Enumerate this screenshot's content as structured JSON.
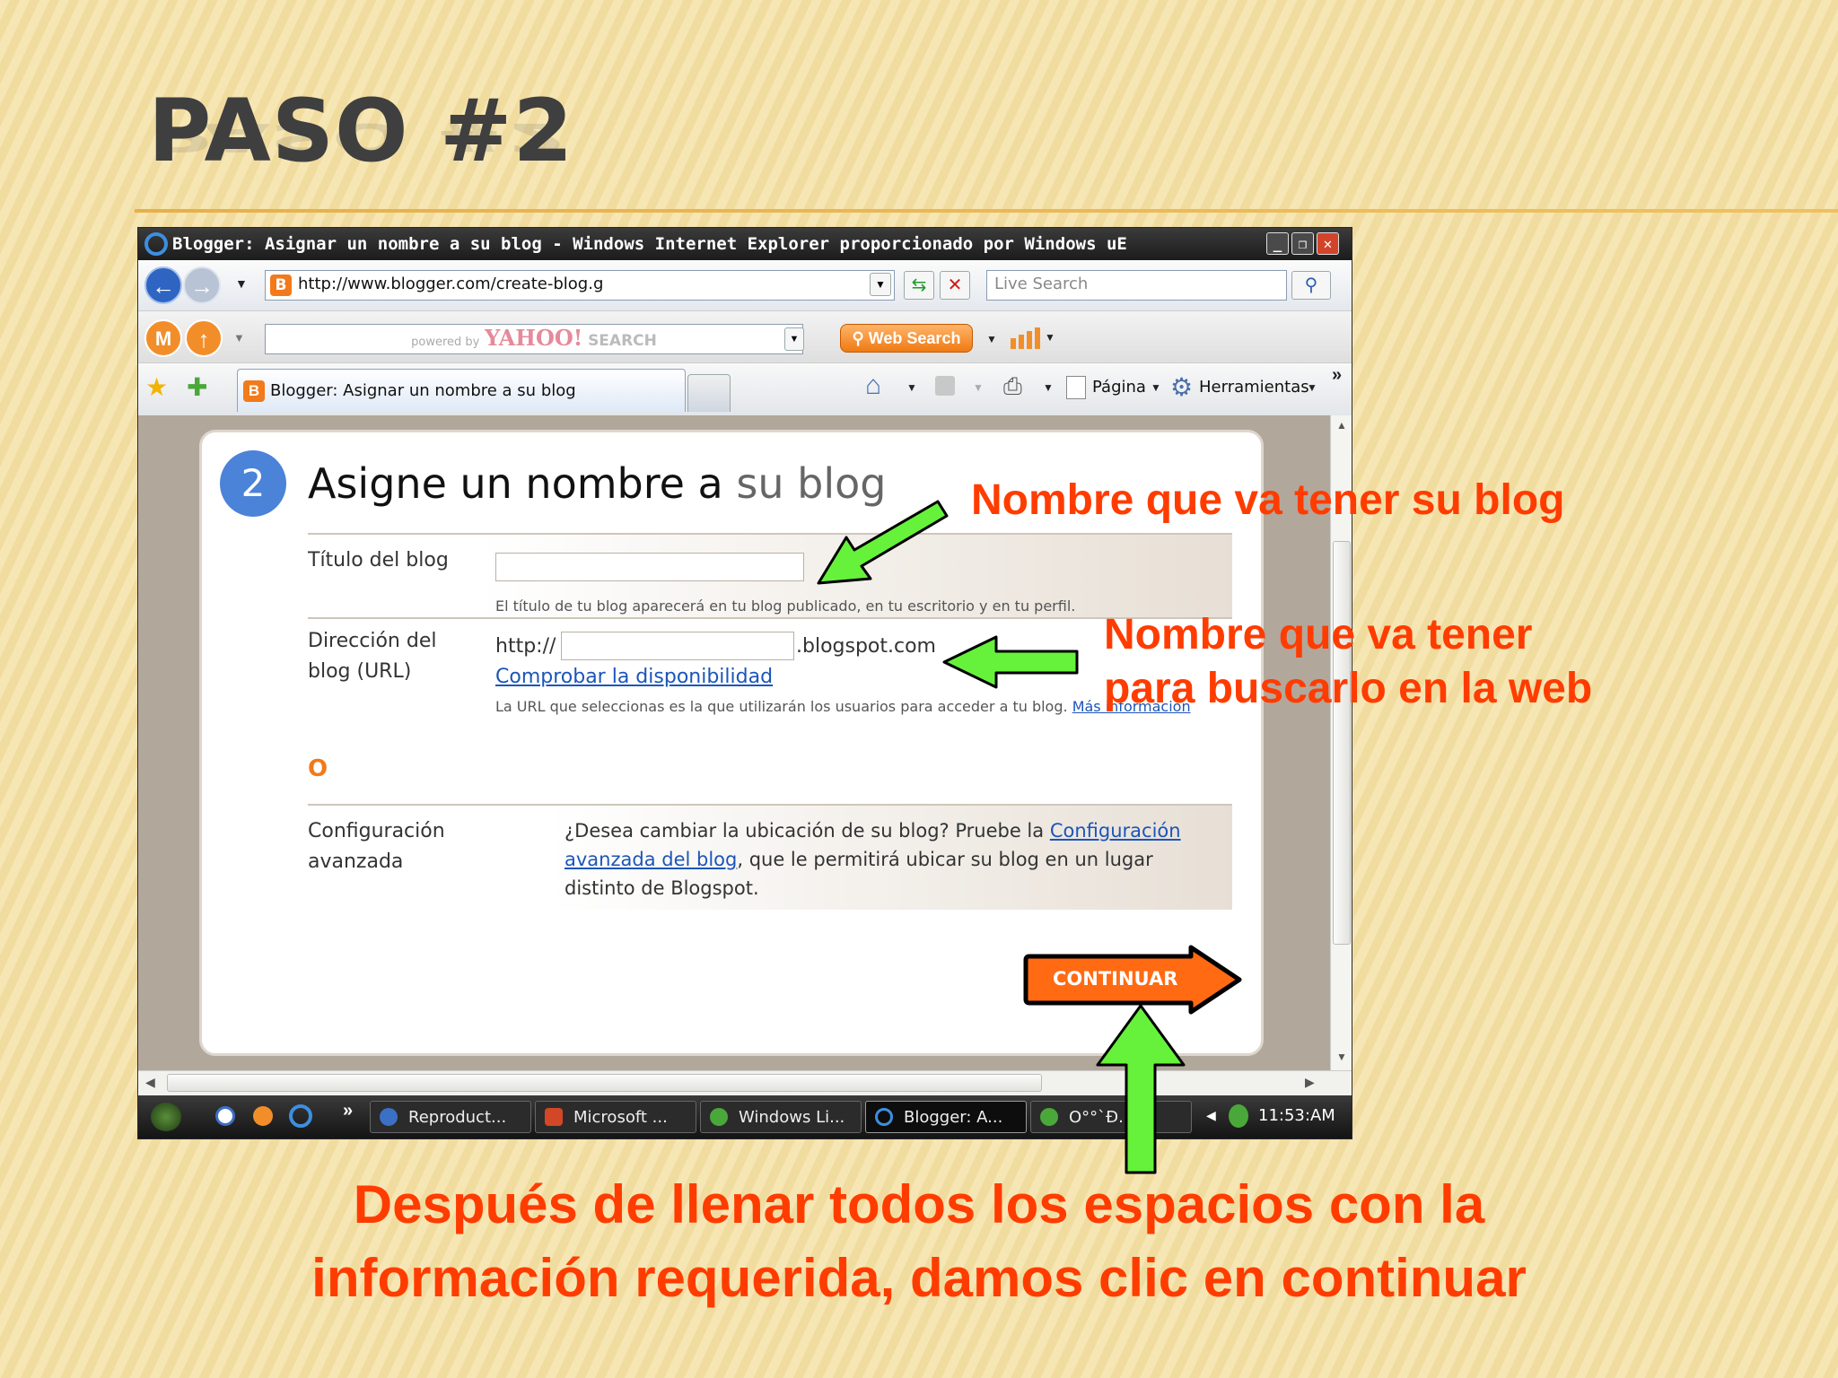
{
  "slide": {
    "title": "PASO #2"
  },
  "browser": {
    "window_title": "Blogger: Asignar un nombre a su blog - Windows Internet Explorer proporcionado por Windows uE",
    "address_url": "http://www.blogger.com/create-blog.g",
    "search_placeholder": "Live Search",
    "yahoo_powered": "powered by",
    "yahoo_brand": "YAHOO!",
    "yahoo_search": "SEARCH",
    "web_search_button": "Web Search",
    "tab_title": "Blogger: Asignar un nombre a su blog",
    "menu_pagina": "Página",
    "menu_herramientas": "Herramientas",
    "more_chevron": "»"
  },
  "form": {
    "step_number": "2",
    "heading_main": "Asigne un nombre a",
    "heading_sub": "su blog",
    "title_label": "Título del blog",
    "title_hint": "El título de tu blog aparecerá en tu blog publicado, en tu escritorio y en tu perfil.",
    "url_label_line1": "Dirección del",
    "url_label_line2": "blog (URL)",
    "url_prefix": "http://",
    "url_suffix": ".blogspot.com",
    "check_link": "Comprobar la disponibilidad",
    "url_hint": "La URL que seleccionas es la que utilizarán los usuarios para acceder a tu blog.",
    "more_info_link": "Más información",
    "or_text": "O",
    "advanced_label_line1": "Configuración",
    "advanced_label_line2": "avanzada",
    "advanced_text_1": "¿Desea cambiar la ubicación de su blog? Pruebe la",
    "advanced_link_1": "Configuración",
    "advanced_link_2": "avanzada del blog",
    "advanced_text_2": ", que le permitirá ubicar su blog en un lugar distinto de",
    "advanced_text_3": "Blogspot.",
    "continue_button": "CONTINUAR"
  },
  "taskbar": {
    "items": [
      "Reproduct...",
      "Microsoft ...",
      "Windows Li...",
      "Blogger: A...",
      "O°°`Ð..."
    ],
    "clock": "11:53:AM",
    "chevron": "»"
  },
  "annotations": {
    "blog_name": "Nombre que va tener su blog",
    "web_name_line1": "Nombre que va tener",
    "web_name_line2": "para buscarlo en la web",
    "footer_line1": "Después de llenar todos los espacios con la",
    "footer_line2": "información requerida, damos clic en continuar"
  },
  "colors": {
    "annotation_red": "#ff3c00",
    "arrow_green": "#66f23a",
    "continue_orange": "#ff6a13",
    "link_blue": "#1c55b8",
    "step_blue": "#4a83d8"
  }
}
